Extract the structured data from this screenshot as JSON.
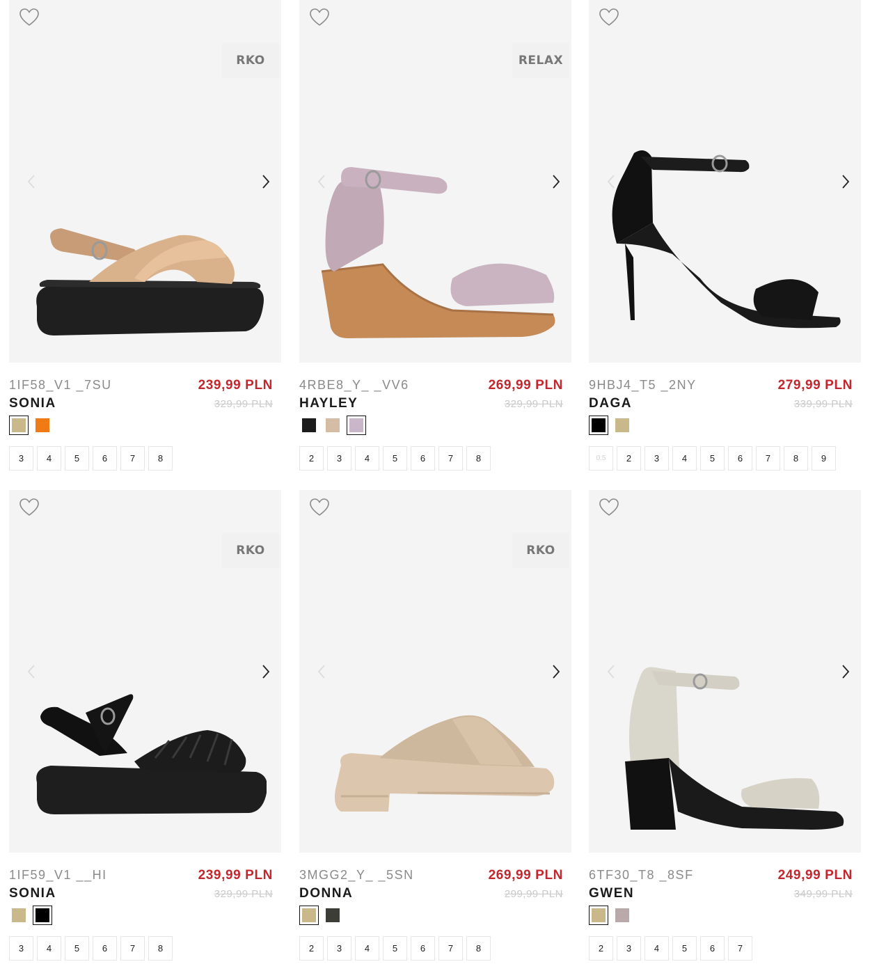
{
  "products": [
    {
      "code": "1IF58_V1 _7SU",
      "name": "SONIA",
      "price": "239,99 PLN",
      "old_price": "329,99 PLN",
      "badge": "RKO",
      "image": "beige-platform-crossover-sandal",
      "colors": [
        {
          "hex": "#c9b88a",
          "selected": true
        },
        {
          "hex": "#f07a14",
          "selected": false
        }
      ],
      "sizes": [
        "3",
        "4",
        "5",
        "6",
        "7",
        "8"
      ]
    },
    {
      "code": "4RBE8_Y_ _VV6",
      "name": "HAYLEY",
      "price": "269,99 PLN",
      "old_price": "329,99 PLN",
      "badge": "RELAX",
      "image": "lilac-jute-wedge-sandal",
      "colors": [
        {
          "hex": "#1c1c1c",
          "selected": false
        },
        {
          "hex": "#d5bda5",
          "selected": false
        },
        {
          "hex": "#c9b6c9",
          "selected": true
        }
      ],
      "sizes": [
        "2",
        "3",
        "4",
        "5",
        "6",
        "7",
        "8"
      ]
    },
    {
      "code": "9HBJ4_T5 _2NY",
      "name": "DAGA",
      "price": "279,99 PLN",
      "old_price": "339,99 PLN",
      "badge": "",
      "image": "black-stiletto-ankle-strap-sandal",
      "colors": [
        {
          "hex": "#000000",
          "selected": true
        },
        {
          "hex": "#c9b88a",
          "selected": false
        }
      ],
      "sizes": [
        "0.5",
        "2",
        "3",
        "4",
        "5",
        "6",
        "7",
        "8",
        "9"
      ],
      "unavailable_sizes": [
        "0.5"
      ]
    },
    {
      "code": "1IF59_V1 __HI",
      "name": "SONIA",
      "price": "239,99 PLN",
      "old_price": "329,99 PLN",
      "badge": "RKO",
      "image": "black-platform-quilted-sandal",
      "colors": [
        {
          "hex": "#c9b88a",
          "selected": false
        },
        {
          "hex": "#000000",
          "selected": true
        }
      ],
      "sizes": [
        "3",
        "4",
        "5",
        "6",
        "7",
        "8"
      ]
    },
    {
      "code": "3MGG2_Y_ _5SN",
      "name": "DONNA",
      "price": "269,99 PLN",
      "old_price": "299,99 PLN",
      "badge": "RKO",
      "image": "beige-chunky-mule",
      "colors": [
        {
          "hex": "#c9b88a",
          "selected": true
        },
        {
          "hex": "#3d3d38",
          "selected": false
        }
      ],
      "sizes": [
        "2",
        "3",
        "4",
        "5",
        "6",
        "7",
        "8"
      ]
    },
    {
      "code": "6TF30_T8 _8SF",
      "name": "GWEN",
      "price": "249,99 PLN",
      "old_price": "349,99 PLN",
      "badge": "",
      "image": "cream-block-heel-sandal",
      "colors": [
        {
          "hex": "#c9b88a",
          "selected": true
        },
        {
          "hex": "#b9a9ab",
          "selected": false
        }
      ],
      "sizes": [
        "2",
        "3",
        "4",
        "5",
        "6",
        "7"
      ]
    }
  ]
}
